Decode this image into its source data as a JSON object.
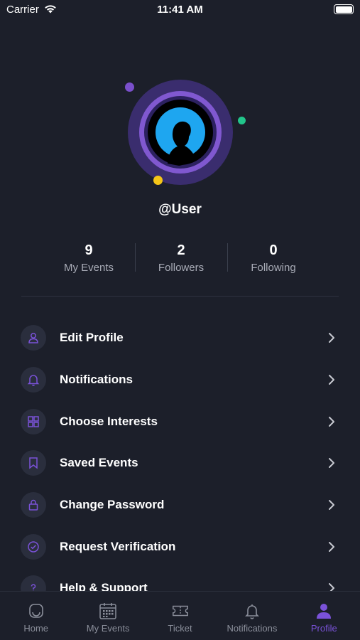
{
  "status_bar": {
    "carrier": "Carrier",
    "time": "11:41 AM"
  },
  "profile": {
    "username": "@User"
  },
  "stats": [
    {
      "value": "9",
      "label": "My Events"
    },
    {
      "value": "2",
      "label": "Followers"
    },
    {
      "value": "0",
      "label": "Following"
    }
  ],
  "menu": [
    {
      "label": "Edit Profile",
      "icon": "user-icon"
    },
    {
      "label": "Notifications",
      "icon": "bell-icon"
    },
    {
      "label": "Choose Interests",
      "icon": "grid-icon"
    },
    {
      "label": "Saved Events",
      "icon": "bookmark-icon"
    },
    {
      "label": "Change Password",
      "icon": "lock-icon"
    },
    {
      "label": "Request Verification",
      "icon": "check-circle-icon"
    },
    {
      "label": "Help & Support",
      "icon": "question-icon"
    }
  ],
  "tabs": [
    {
      "label": "Home",
      "icon": "home-icon",
      "active": false
    },
    {
      "label": "My Events",
      "icon": "calendar-icon",
      "active": false
    },
    {
      "label": "Ticket",
      "icon": "ticket-icon",
      "active": false
    },
    {
      "label": "Notifications",
      "icon": "bell-icon",
      "active": false
    },
    {
      "label": "Profile",
      "icon": "profile-icon",
      "active": true
    }
  ],
  "colors": {
    "background": "#1c1f2a",
    "accent": "#7a52d8",
    "icon_circle": "#2a2e3d",
    "muted_text": "#a8abb6",
    "dot_purple": "#7a4fcb",
    "dot_green": "#22c58b",
    "dot_yellow": "#f5c518",
    "avatar_blue": "#1ea6f0"
  }
}
